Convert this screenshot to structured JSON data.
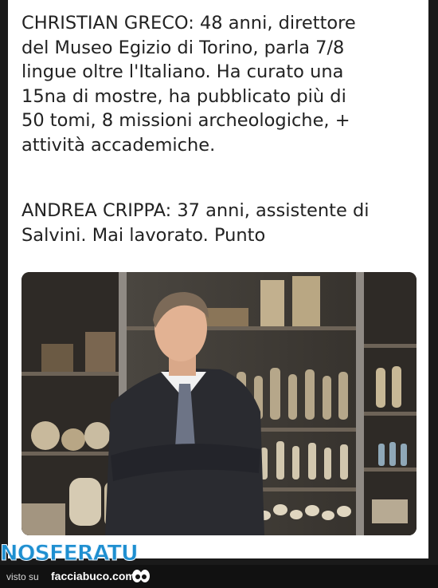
{
  "post": {
    "paragraph_1": "CHRISTIAN GRECO: 48 anni, direttore\ndel Museo Egizio di Torino, parla 7/8\nlingue oltre l'Italiano. Ha curato una\n15na di mostre, ha pubblicato più di\n50 tomi, 8 missioni archeologiche, +\nattività accademiche.",
    "paragraph_2": "ANDREA CRIPPA: 37 anni, assistente di\nSalvini. Mai lavorato.  Punto"
  },
  "watermark": {
    "text": "NOSFERATU"
  },
  "footer": {
    "visto_su": "visto su",
    "site": "facciabuco.com"
  },
  "colors": {
    "background": "#1a1a1a",
    "card": "#ffffff",
    "text": "#222222",
    "watermark": "#1e8fd0"
  }
}
